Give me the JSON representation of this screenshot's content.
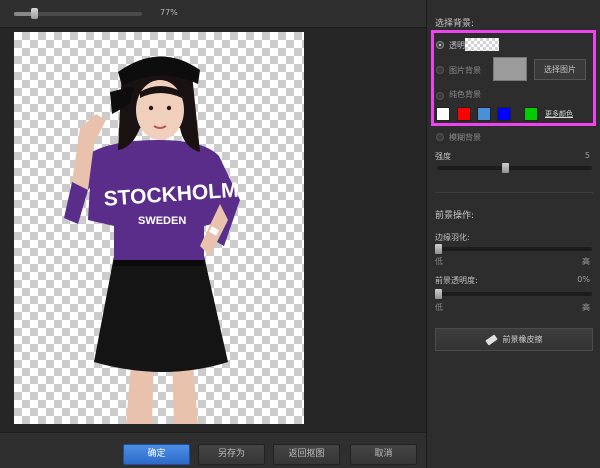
{
  "zoom": {
    "value_label": "77%",
    "fraction": 0.77
  },
  "canvas": {
    "shirt_text_line1": "STOCKHOLM",
    "shirt_text_line2": "SWEDEN"
  },
  "bottom_buttons": {
    "ok": "确定",
    "save_as": "另存为",
    "back_to_cutout": "返回抠图",
    "cancel": "取消"
  },
  "right_panel": {
    "background_section": {
      "title": "选择背景:",
      "transparent_label": "透明背景",
      "image_label": "图片背景",
      "choose_image_button": "选择图片",
      "solid_label": "纯色背景",
      "solid_colors": [
        "#ffffff",
        "#ff0000",
        "#4a90d9",
        "#0000ff",
        "#00cc00"
      ],
      "more_colors_link": "更多颜色",
      "blur_label": "模糊背景",
      "strength_label": "强度",
      "strength_value": "5",
      "selected_option": "transparent"
    },
    "foreground_section": {
      "title": "前景操作:",
      "feather_label": "边缘羽化:",
      "feather_low": "低",
      "feather_high": "高",
      "opacity_label": "前景透明度:",
      "opacity_value": "0%",
      "opacity_low": "低",
      "opacity_high": "高",
      "eraser_button": "前景橡皮擦"
    },
    "highlight_color": "#ee44ee"
  }
}
